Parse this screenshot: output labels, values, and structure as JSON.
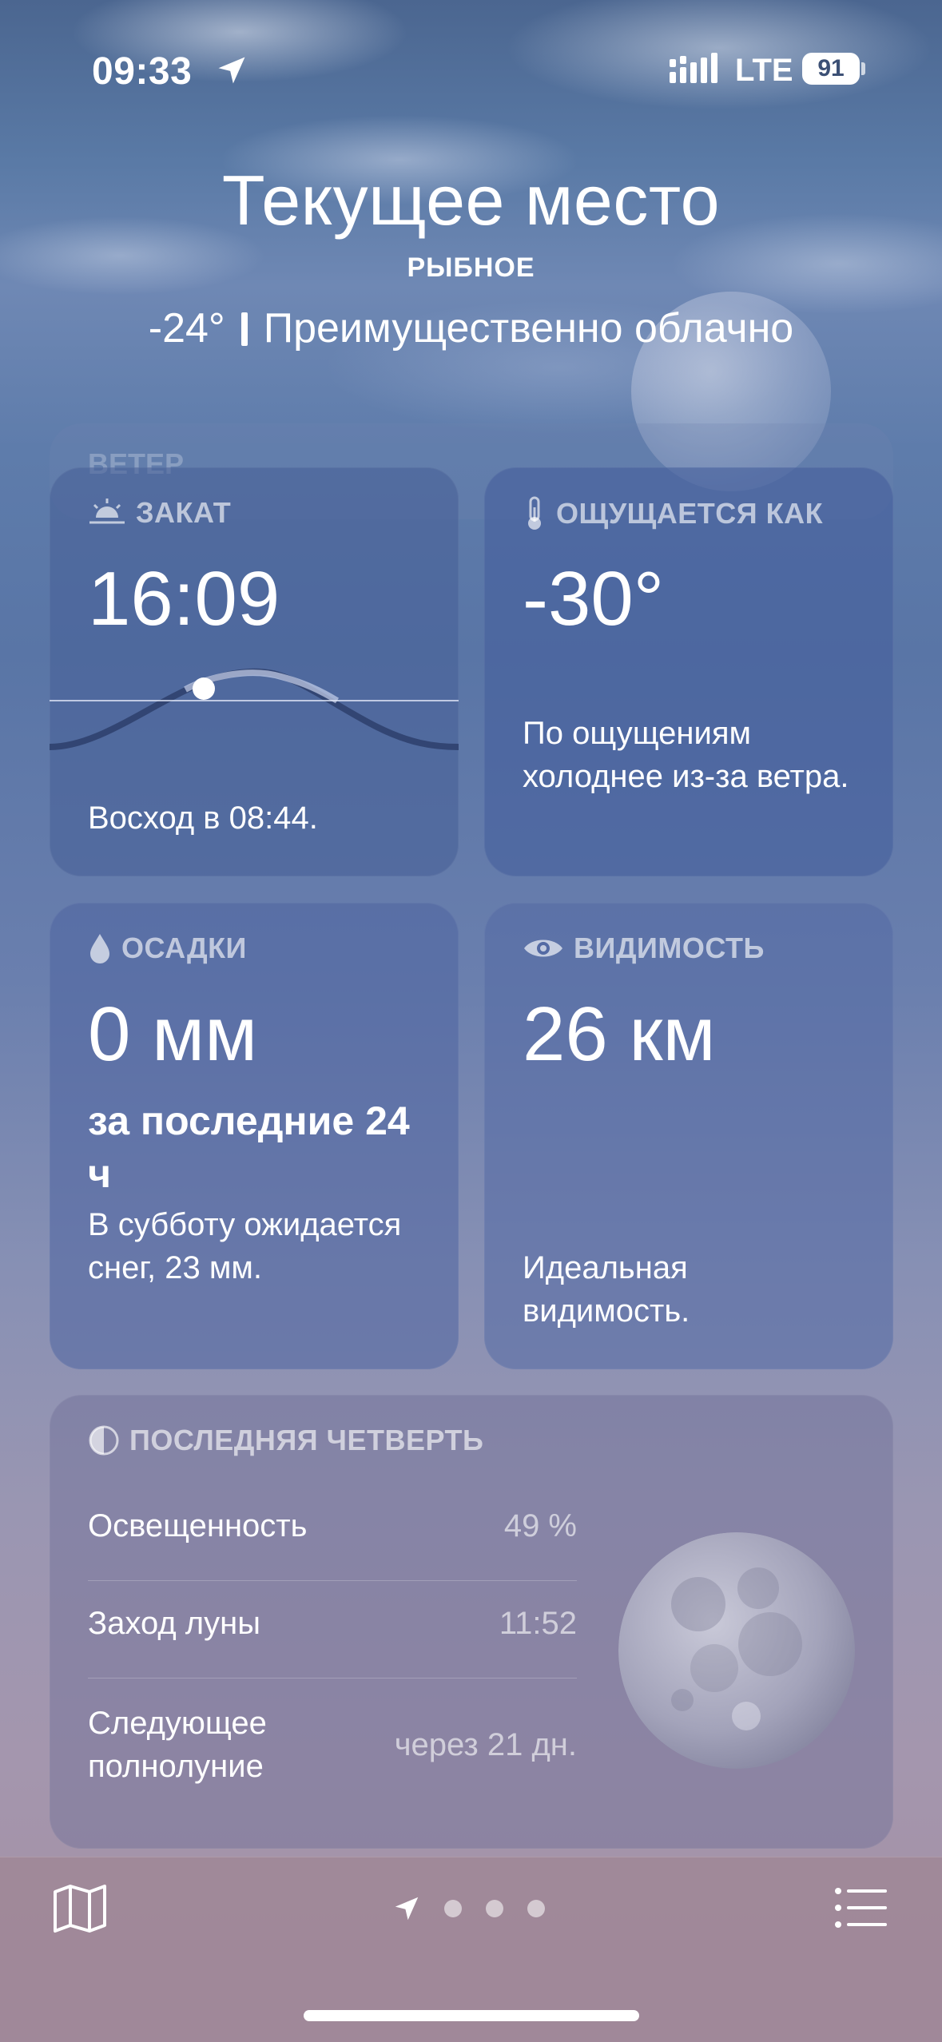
{
  "status_bar": {
    "time": "09:33",
    "network": "LTE",
    "battery": "91"
  },
  "header": {
    "place": "Текущее место",
    "sub_place": "РЫБНОЕ",
    "temperature": "-24°",
    "condition": "Преимущественно облачно"
  },
  "ghost_card": {
    "label": "ВЕТЕР"
  },
  "sunset": {
    "label": "ЗАКАТ",
    "value": "16:09",
    "desc": "Восход в 08:44."
  },
  "feels_like": {
    "label": "ОЩУЩАЕТСЯ КАК",
    "value": "-30°",
    "desc": "По ощущениям холоднее из-за ветра."
  },
  "precipitation": {
    "label": "ОСАДКИ",
    "value": "0 мм",
    "period": "за последние 24 ч",
    "desc": "В субботу ожидается снег, 23 мм."
  },
  "visibility": {
    "label": "ВИДИМОСТЬ",
    "value": "26 км",
    "desc": "Идеальная видимость."
  },
  "moon": {
    "label": "ПОСЛЕДНЯЯ ЧЕТВЕРТЬ",
    "rows": [
      {
        "key": "Освещенность",
        "value": "49 %"
      },
      {
        "key": "Заход луны",
        "value": "11:52"
      },
      {
        "key": "Следующее полнолуние",
        "value": "через 21 дн."
      }
    ]
  },
  "bottom_bar": {
    "icons": [
      "map-icon",
      "location-arrow-icon",
      "list-icon"
    ],
    "page_count": 4,
    "current_page": 0
  },
  "colors": {
    "accent": "#ffffff",
    "card": "#4e669e",
    "bottom_bar": "#a08898"
  }
}
